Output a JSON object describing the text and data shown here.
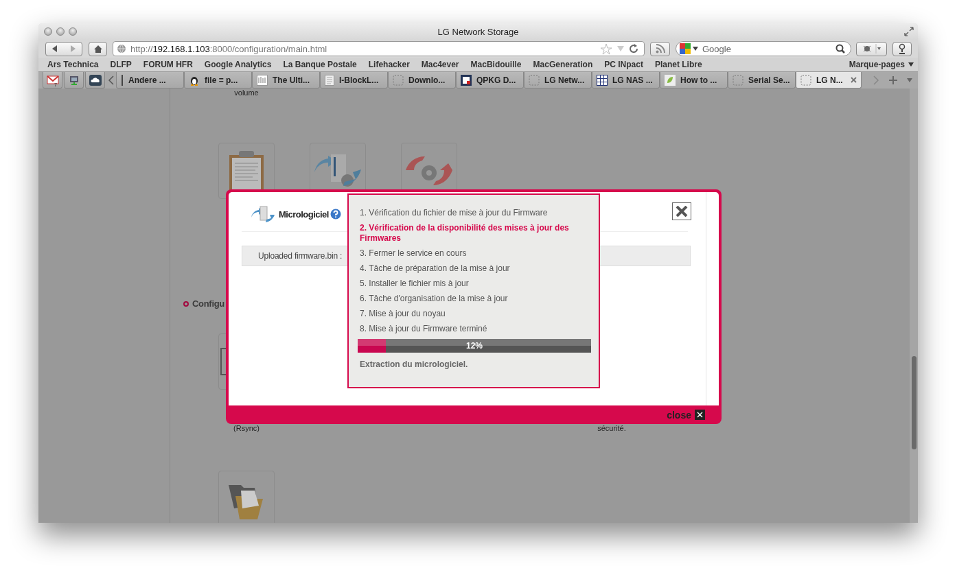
{
  "window": {
    "title": "LG Network Storage"
  },
  "toolbar": {
    "url": {
      "scheme": "http://",
      "host": "192.168.1.103",
      "path": ":8000/configuration/main.html"
    },
    "search": {
      "placeholder": "Google"
    }
  },
  "bookmarks": [
    "Ars Technica",
    "DLFP",
    "FORUM HFR",
    "Google Analytics",
    "La Banque Postale",
    "Lifehacker",
    "Mac4ever",
    "MacBidouille",
    "MacGeneration",
    "PC INpact",
    "Planet Libre"
  ],
  "bookmarks_menu": "Marque-pages",
  "pinned_tabs": [
    {
      "kind": "mail",
      "badge": "7"
    },
    {
      "kind": "monitor"
    },
    {
      "kind": "cloud"
    }
  ],
  "tabs": [
    {
      "label": "Andere ...",
      "kind": "bar",
      "selected": false
    },
    {
      "label": "file = p...",
      "kind": "penguin",
      "selected": false
    },
    {
      "label": "The Ulti...",
      "kind": "thumb",
      "selected": false
    },
    {
      "label": "I-BlockL...",
      "kind": "doc",
      "selected": false
    },
    {
      "label": "Downlo...",
      "kind": "blank",
      "selected": false
    },
    {
      "label": "QPKG D...",
      "kind": "qpkg",
      "selected": false
    },
    {
      "label": "LG Netw...",
      "kind": "blank",
      "selected": false
    },
    {
      "label": "LG NAS ...",
      "kind": "grid",
      "selected": false
    },
    {
      "label": "How to ...",
      "kind": "leaf",
      "selected": false
    },
    {
      "label": "Serial Se...",
      "kind": "blank",
      "selected": false
    },
    {
      "label": "LG N...",
      "kind": "blank",
      "selected": true
    }
  ],
  "page": {
    "top_label": "volume",
    "section_heading": "Configu",
    "row2_labels": [
      "(Rsync)",
      "sécurité."
    ]
  },
  "dialog": {
    "title": "Micrologiciel",
    "field_label": "Uploaded firmware.bin :",
    "close_label": "close",
    "steps": [
      {
        "text": "1. Vérification du fichier de mise à jour du Firmware",
        "selected": false
      },
      {
        "text": "2. Vérification de la disponibilité des mises à jour des Firmwares",
        "selected": true
      },
      {
        "text": "3. Fermer le service en cours",
        "selected": false
      },
      {
        "text": "4. Tâche de préparation de la mise à jour",
        "selected": false
      },
      {
        "text": "5. Installer le fichier mis à jour",
        "selected": false
      },
      {
        "text": "6. Tâche d'organisation de la mise à jour",
        "selected": false
      },
      {
        "text": "7. Mise à jour du noyau",
        "selected": false
      },
      {
        "text": "8. Mise à jour du Firmware terminé",
        "selected": false
      }
    ],
    "progress": {
      "level": 0.12,
      "reading": "12%"
    },
    "status": "Extraction du micrologiciel."
  }
}
